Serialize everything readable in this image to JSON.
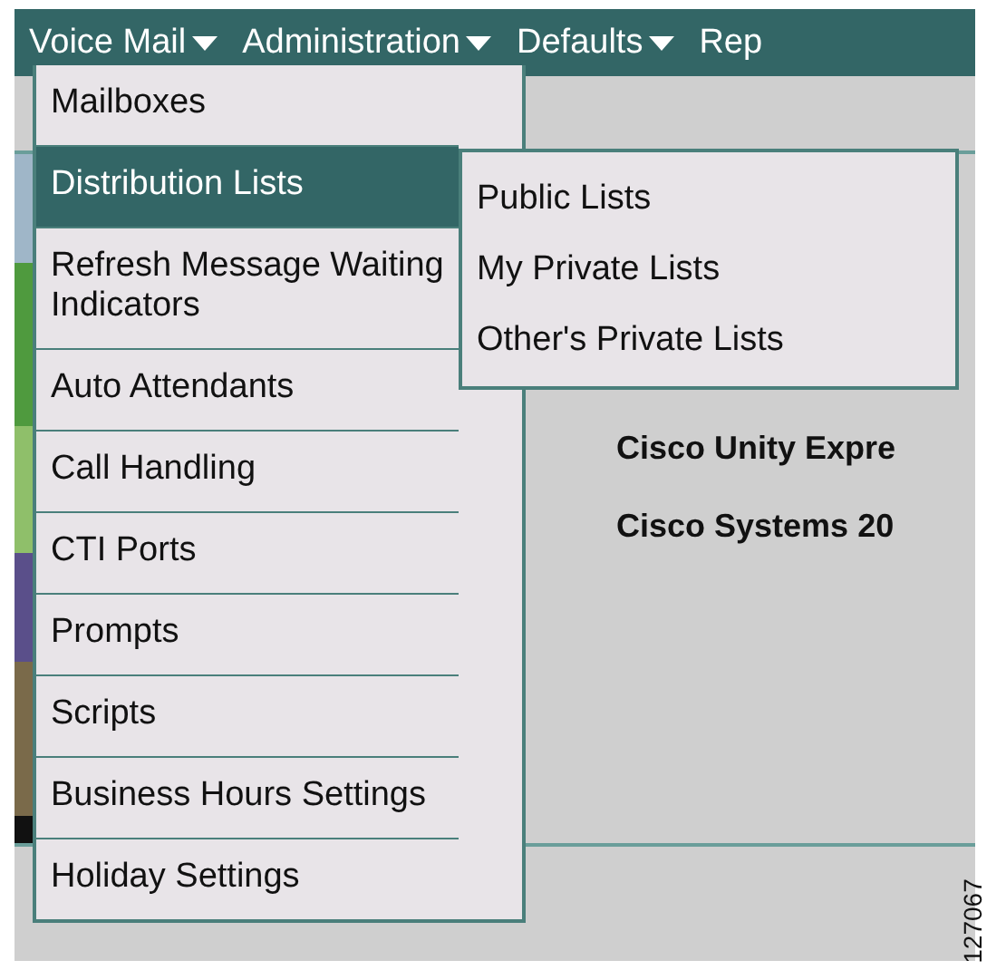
{
  "menu_bar": [
    {
      "label": "Voice Mail",
      "caret": true
    },
    {
      "label": "Administration",
      "caret": true
    },
    {
      "label": "Defaults",
      "caret": true
    },
    {
      "label": "Rep",
      "caret": false
    }
  ],
  "dropdown": [
    {
      "label": "Mailboxes",
      "selected": false
    },
    {
      "label": "Distribution Lists",
      "selected": true
    },
    {
      "label": "Refresh Message Waiting Indicators",
      "selected": false
    },
    {
      "label": "Auto Attendants",
      "selected": false
    },
    {
      "label": "Call Handling",
      "selected": false
    },
    {
      "label": "CTI Ports",
      "selected": false
    },
    {
      "label": "Prompts",
      "selected": false
    },
    {
      "label": "Scripts",
      "selected": false
    },
    {
      "label": "Business Hours Settings",
      "selected": false
    },
    {
      "label": "Holiday Settings",
      "selected": false
    }
  ],
  "submenu": [
    {
      "label": "Public Lists",
      "selected": false
    },
    {
      "label": "My Private Lists",
      "selected": false
    },
    {
      "label": "Other's Private Lists",
      "selected": false
    }
  ],
  "content": [
    "Cisco Unity Expre",
    "Cisco Systems 20"
  ],
  "figure_id": "127067"
}
